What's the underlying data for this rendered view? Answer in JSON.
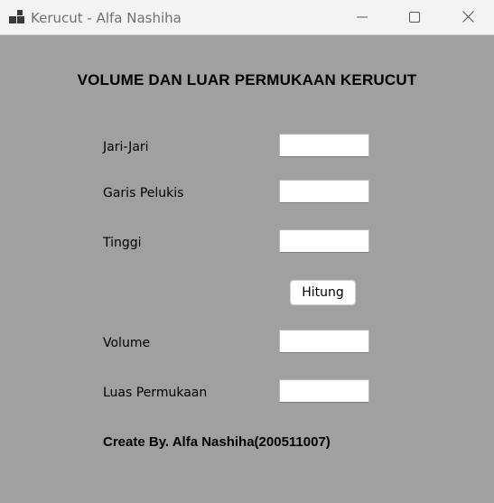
{
  "window": {
    "title": "Kerucut - Alfa Nashiha"
  },
  "form": {
    "heading": "VOLUME DAN LUAR PERMUKAAN KERUCUT",
    "labels": {
      "jari_jari": "Jari-Jari",
      "garis_pelukis": "Garis Pelukis",
      "tinggi": "Tinggi",
      "volume": "Volume",
      "luas_permukaan": "Luas Permukaan"
    },
    "inputs": {
      "jari_jari": "",
      "garis_pelukis": "",
      "tinggi": "",
      "volume": "",
      "luas_permukaan": ""
    },
    "button_label": "Hitung",
    "footer": "Create By. Alfa Nashiha(200511007)"
  },
  "icons": {
    "app": "app-icon",
    "minimize": "minimize-icon",
    "maximize": "maximize-icon",
    "close": "close-icon"
  },
  "colors": {
    "form_background": "#a0a0a0",
    "titlebar_background": "#f3f3f3"
  }
}
